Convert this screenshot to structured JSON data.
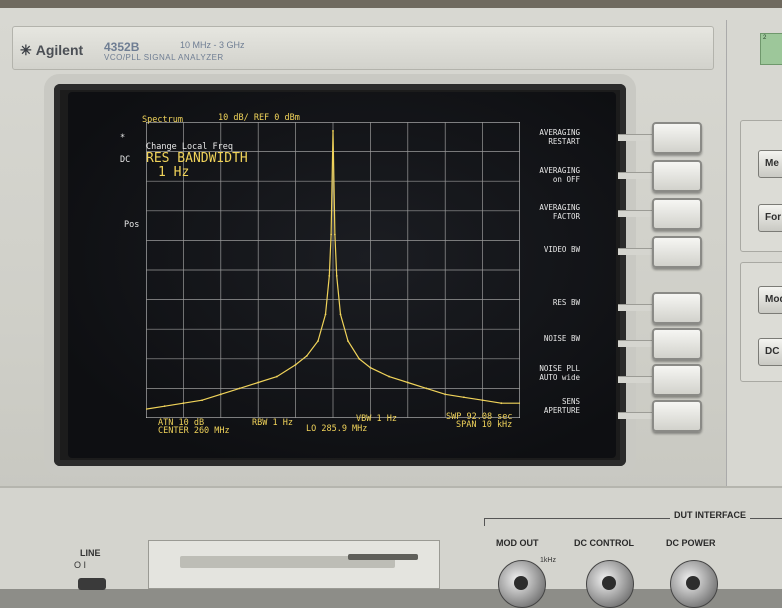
{
  "header": {
    "brand": "Agilent",
    "model": "4352B",
    "freq_range": "10 MHz - 3 GHz",
    "model_sub": "VCO/PLL  SIGNAL  ANALYZER"
  },
  "screen": {
    "title": "Spectrum",
    "scale": "10 dB/ REF 0 dBm",
    "marker_star": "*",
    "dc_label": "DC",
    "pos_label": "Pos",
    "change_text": "Change Local Freq",
    "active_param": "RES BANDWIDTH",
    "active_value": "1 Hz",
    "footer": {
      "atn": "ATN  10 dB",
      "center": "CENTER  260 MHz",
      "rbw": "RBW  1 Hz",
      "vbw": "VBW  1 Hz",
      "lo": "LO  285.9 MHz",
      "swp": "SWP  92.08 sec",
      "span": "SPAN  10 kHz"
    }
  },
  "softkeys": [
    {
      "line1": "AVERAGING",
      "line2": "RESTART"
    },
    {
      "line1": "AVERAGING",
      "line2": "on OFF"
    },
    {
      "line1": "AVERAGING",
      "line2": "FACTOR"
    },
    {
      "line1": "VIDEO BW",
      "line2": ""
    },
    {
      "line1": "RES BW",
      "line2": ""
    },
    {
      "line1": "NOISE BW",
      "line2": ""
    },
    {
      "line1": "NOISE PLL",
      "line2": "AUTO wide"
    },
    {
      "line1": "SENS",
      "line2": "APERTURE"
    }
  ],
  "right_panel": {
    "btn1": "Me",
    "btn2": "For",
    "btn3": "Mod",
    "btn4": "DC",
    "tag": "2"
  },
  "lower": {
    "line_label": "LINE",
    "line_symbols": "O  I",
    "dut_interface": "DUT INTERFACE",
    "mod_out": "MOD OUT",
    "khz": "1kHz",
    "dc_control": "DC CONTROL",
    "dc_power": "DC POWER"
  },
  "chart_data": {
    "type": "line",
    "xlabel": "",
    "ylabel": "",
    "grid": true,
    "x": [
      -5,
      -4.5,
      -4,
      -3.5,
      -3,
      -2.5,
      -2,
      -1.5,
      -1,
      -0.7,
      -0.4,
      -0.2,
      -0.1,
      -0.05,
      0,
      0.05,
      0.1,
      0.2,
      0.4,
      0.7,
      1,
      1.5,
      2,
      2.5,
      3,
      3.5,
      4,
      4.5,
      5
    ],
    "y": [
      -97,
      -96,
      -95,
      -94,
      -92,
      -90,
      -88,
      -86,
      -82,
      -79,
      -74,
      -65,
      -52,
      -38,
      -3,
      -38,
      -52,
      -65,
      -74,
      -80,
      -83,
      -86,
      -88,
      -90,
      -92,
      -93,
      -94,
      -95,
      -95
    ],
    "xlim": [
      -5,
      5
    ],
    "ylim": [
      -100,
      0
    ],
    "x_unit": "kHz offset",
    "color": "#f0d35a"
  }
}
